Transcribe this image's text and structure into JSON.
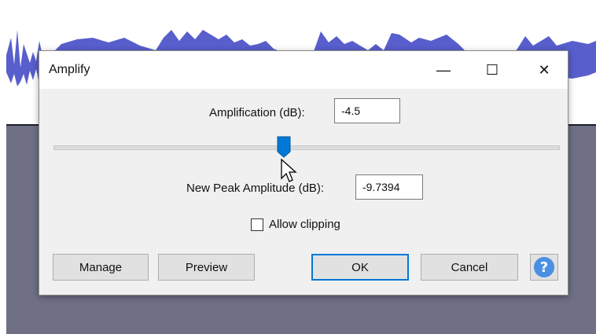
{
  "dialog": {
    "title": "Amplify",
    "amplification_label": "Amplification (dB):",
    "amplification_value": "-4.5",
    "slider_level": 0.45,
    "peak_label": "New Peak Amplitude (dB):",
    "peak_value": "-9.7394",
    "allow_clipping_label": "Allow clipping",
    "allow_clipping_checked": false,
    "buttons": {
      "manage": "Manage",
      "preview": "Preview",
      "ok": "OK",
      "cancel": "Cancel",
      "help": "?"
    },
    "window_controls": {
      "minimize": "—",
      "maximize": "☐",
      "close": "✕"
    }
  },
  "colors": {
    "waveform": "#4f55c9",
    "empty_track_area": "#6f6f86",
    "slider_thumb": "#0078d7",
    "help_icon": "#4a90e2"
  }
}
